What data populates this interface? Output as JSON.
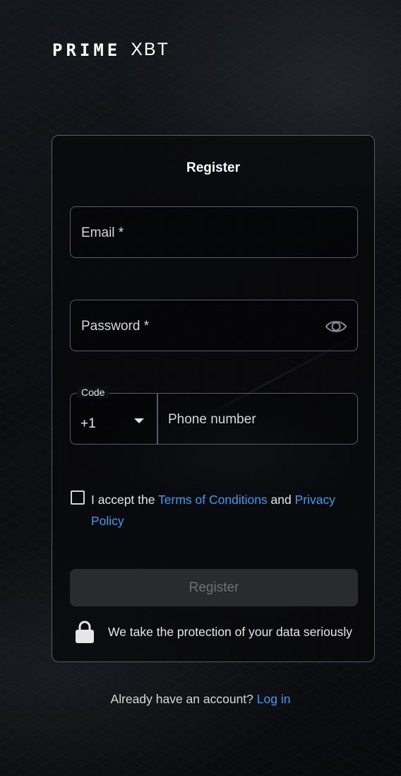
{
  "brand": {
    "prime": "PRIME",
    "xbt": "XBT"
  },
  "form": {
    "title": "Register",
    "email_placeholder": "Email *",
    "password_placeholder": "Password *",
    "code_label": "Code",
    "code_value": "+1",
    "phone_placeholder": "Phone number",
    "terms_prefix": "I accept the ",
    "terms_link": "Terms of Conditions",
    "terms_and": " and ",
    "privacy_link": "Privacy Policy",
    "register_button": "Register",
    "security_note": "We take the protection of your data seriously"
  },
  "footer": {
    "question": "Already have an account? ",
    "login_link": "Log in"
  },
  "colors": {
    "link": "#3d9bf0",
    "border": "#5a5d63",
    "button_disabled_bg": "#2a2b2e",
    "button_disabled_text": "#6f7074"
  },
  "icons": {
    "password_toggle": "eye-icon",
    "code_dropdown": "caret-down-icon",
    "security": "lock-icon"
  }
}
